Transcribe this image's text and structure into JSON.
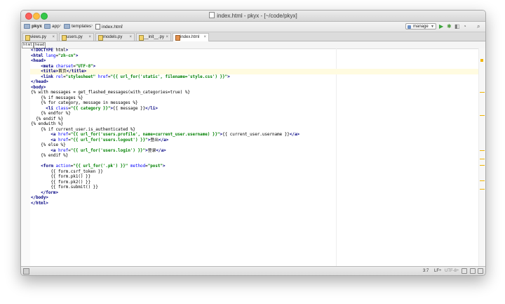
{
  "window": {
    "title": "index.html - pkyx - [~/code/pkyx]"
  },
  "navbar": {
    "breadcrumbs": [
      {
        "label": "pkyx",
        "icon": "folder-icon"
      },
      {
        "label": "app",
        "icon": "folder-icon"
      },
      {
        "label": "templates",
        "icon": "folder-icon"
      },
      {
        "label": "index.html",
        "icon": "html-file-icon"
      }
    ],
    "run_config": "manage",
    "tools": [
      "run-icon",
      "debug-icon",
      "coverage-icon",
      "profile-icon",
      "search-icon"
    ]
  },
  "tabs": [
    {
      "label": "views.py",
      "active": false
    },
    {
      "label": "users.py",
      "active": false
    },
    {
      "label": "models.py",
      "active": false
    },
    {
      "label": "__init__.py",
      "active": false
    },
    {
      "label": "index.html",
      "active": true
    }
  ],
  "editor": {
    "tag_breadcrumbs": [
      "html",
      "head"
    ],
    "lines": [
      "<!DOCTYPE html>",
      "<html lang=\"zh-cn\">",
      "<head>",
      "    <meta charset=\"UTF-8\">",
      "    <title>首页</title>",
      "    <link rel=\"stylesheet\" href=\"{{ url_for('static', filename='style.css') }}\">",
      "</head>",
      "<body>",
      "{% with messages = get_flashed_messages(with_categories=true) %}",
      "    {% if messages %}",
      "    {% for category, message in messages %}",
      "      <li class=\"{{ category }}\">{{ message }}</li>",
      "    {% endfor %}",
      "  {% endif %}",
      "{% endwith %}",
      "    {% if current_user.is_authenticated %}",
      "        <a href=\"{{ url_for('users.profile', name=current_user.username) }}\">{{ current_user.username }}</a>",
      "        <a href=\"{{ url_for('users.logout') }}\">登出</a>",
      "    {% else %}",
      "        <a href=\"{{ url_for('users.login') }}\">登录</a>",
      "    {% endif %}",
      "",
      "    <form action=\"{{ url_for('.pk') }}\" method=\"post\">",
      "        {{ form.csrf_token }}",
      "        {{ form.pk1() }}",
      "        {{ form.pk2() }}",
      "        {{ form.submit() }}",
      "    </form>",
      "</body>",
      "</html>"
    ]
  },
  "statusbar": {
    "position": "3:7",
    "line_sep": "LF÷",
    "encoding": "UTF-8÷"
  }
}
